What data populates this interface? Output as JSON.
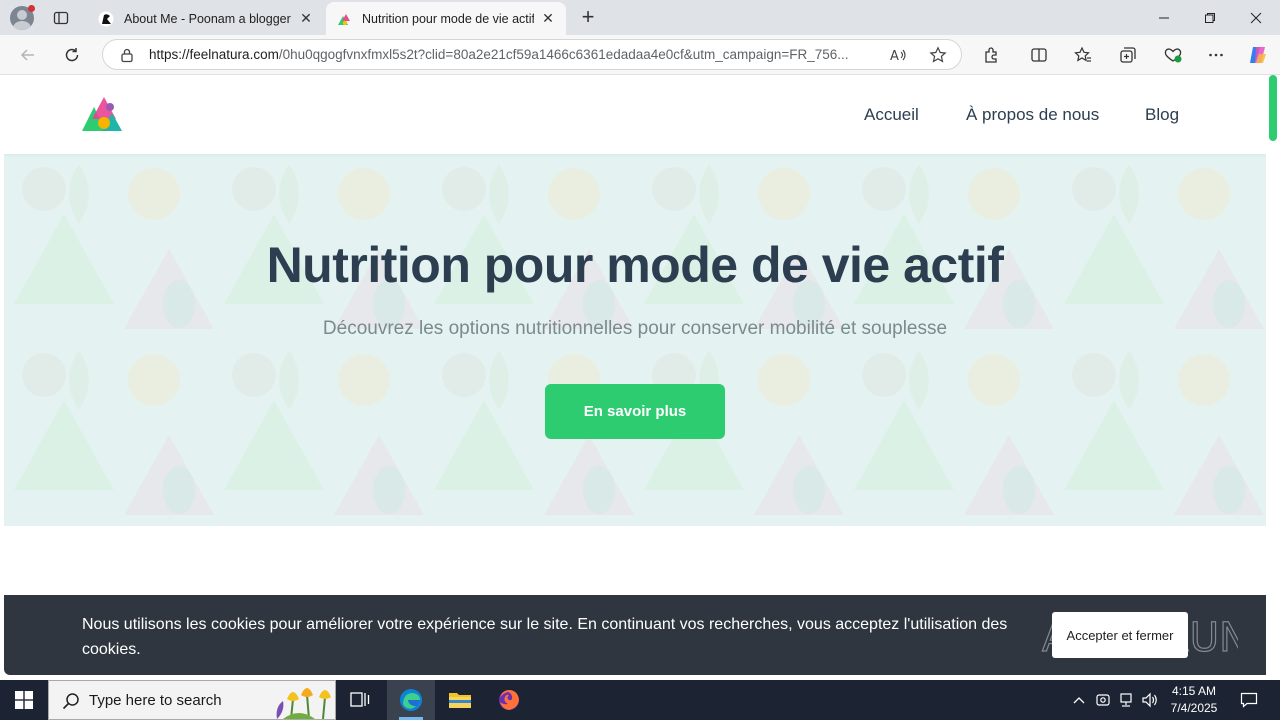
{
  "browser": {
    "tabs": [
      {
        "title": "About Me - Poonam a blogger - I",
        "active": false
      },
      {
        "title": "Nutrition pour mode de vie actif",
        "active": true
      }
    ],
    "url_host": "https://feelnatura.com",
    "url_path": "/0hu0qgogfvnxfmxl5s2t?clid=80a2e21cf59a1466c6361edadaa4e0cf&utm_campaign=FR_756..."
  },
  "site": {
    "nav": [
      "Accueil",
      "À propos de nous",
      "Blog"
    ],
    "hero": {
      "title": "Nutrition pour mode de vie actif",
      "subtitle": "Découvrez les options nutritionnelles pour conserver mobilité et souplesse",
      "cta": "En savoir plus"
    },
    "cookie": {
      "text": "Nous utilisons les cookies pour améliorer votre expérience sur le site. En continuant vos recherches, vous acceptez l'utilisation des cookies.",
      "button": "Accepter et fermer"
    },
    "watermark": "ANY RUN"
  },
  "taskbar": {
    "search_placeholder": "Type here to search",
    "time": "4:15 AM",
    "date": "7/4/2025"
  },
  "colors": {
    "accent": "#2ecc71",
    "heading": "#2c3e50",
    "hero_bg": "#e4f3f1",
    "cookie_bg": "#2f3640",
    "taskbar_bg": "#1c2433"
  }
}
